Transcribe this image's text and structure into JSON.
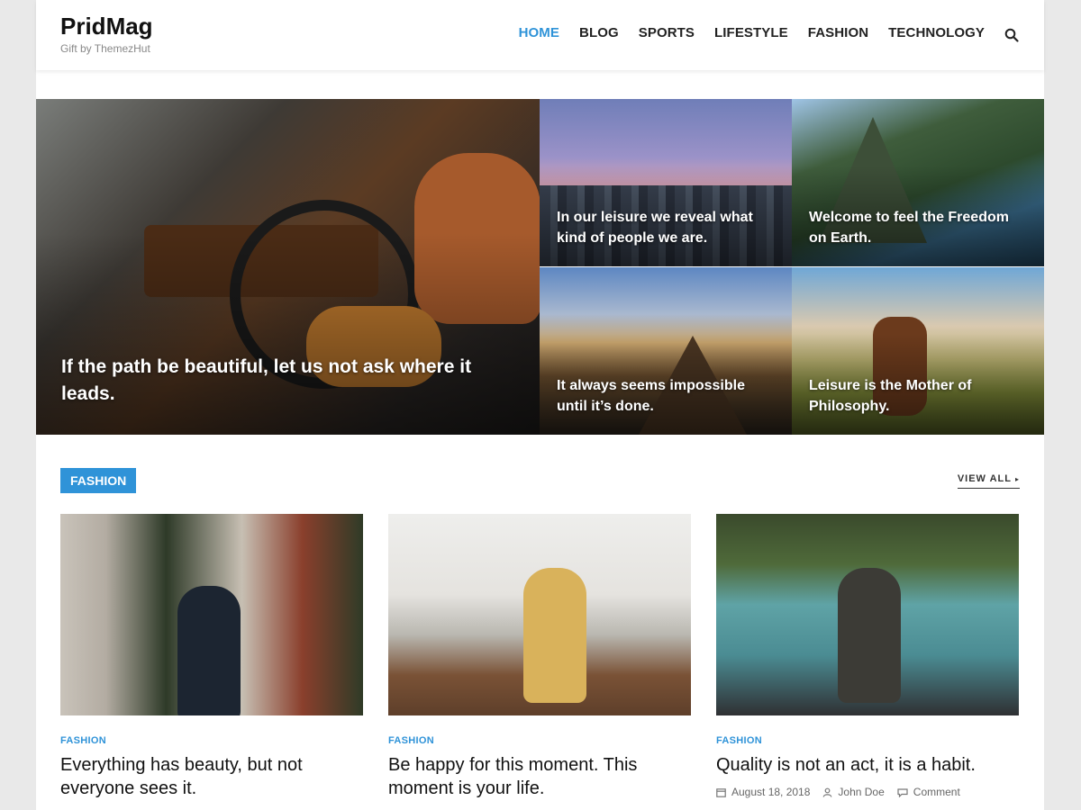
{
  "site": {
    "title": "PridMag",
    "tagline": "Gift by ThemezHut"
  },
  "nav": {
    "items": [
      {
        "label": "HOME",
        "active": true
      },
      {
        "label": "BLOG"
      },
      {
        "label": "SPORTS"
      },
      {
        "label": "LIFESTYLE"
      },
      {
        "label": "FASHION"
      },
      {
        "label": "TECHNOLOGY"
      }
    ],
    "search_icon": "search-icon"
  },
  "hero": {
    "main_caption": "If the path be beautiful, let us not ask where it leads.",
    "tiles": [
      {
        "caption": "In our leisure we reveal what kind of people we are."
      },
      {
        "caption": "Welcome to feel the Freedom on Earth."
      },
      {
        "caption": "It always seems impossible until it’s done."
      },
      {
        "caption": "Leisure is the Mother of Philosophy."
      }
    ]
  },
  "section": {
    "tag": "FASHION",
    "view_all": "VIEW ALL",
    "view_all_arrow": "▸"
  },
  "cards": [
    {
      "category": "FASHION",
      "title": "Everything has beauty, but not everyone sees it."
    },
    {
      "category": "FASHION",
      "title": "Be happy for this moment. This moment is your life."
    },
    {
      "category": "FASHION",
      "title": "Quality is not an act, it is a habit.",
      "date": "August 18, 2018",
      "author": "John Doe",
      "comments": "Comment"
    }
  ],
  "colors": {
    "accent": "#2f93d8"
  }
}
